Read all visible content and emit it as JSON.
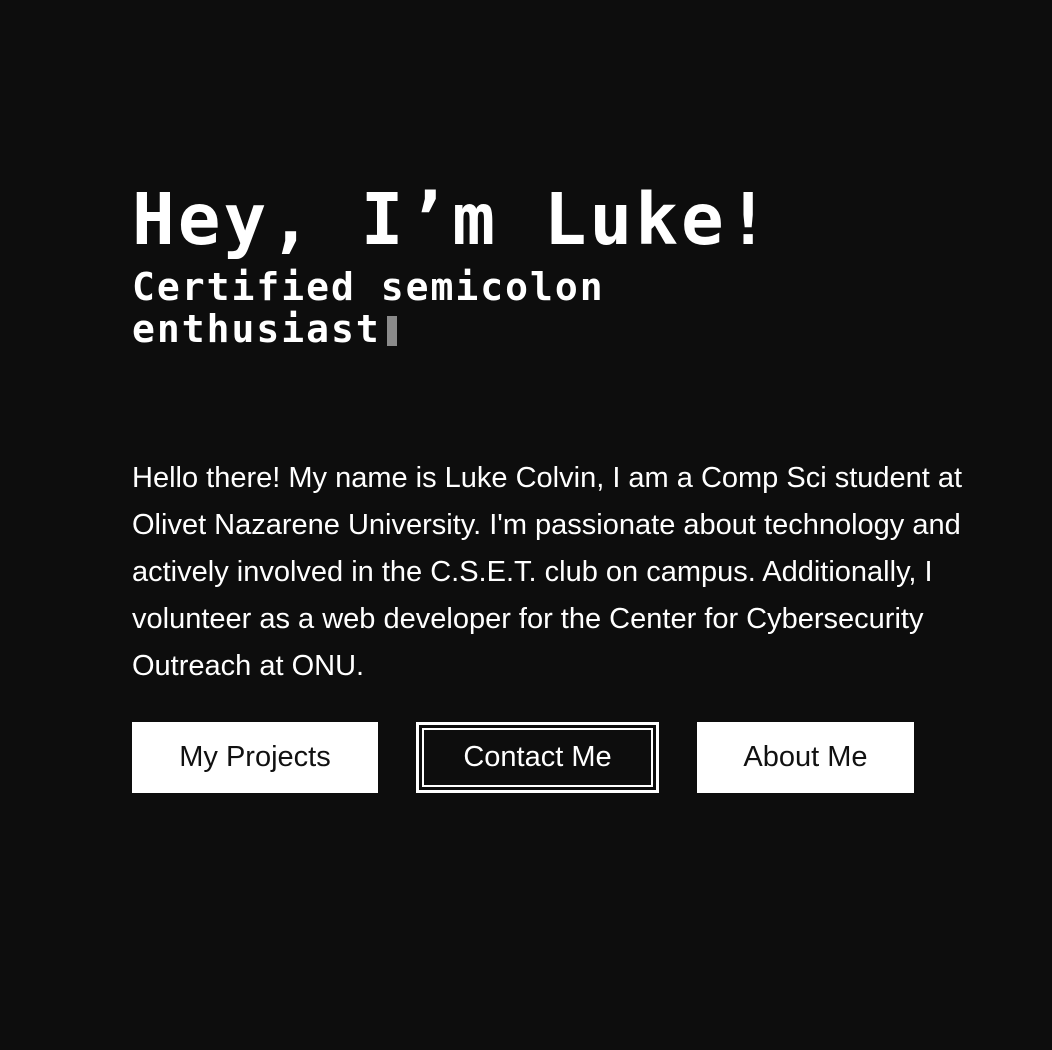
{
  "hero": {
    "headline": "Hey, I’m Luke!",
    "tagline": "Certified semicolon enthusiast"
  },
  "bio": {
    "text": "Hello there! My name is Luke Colvin, I am a Comp Sci student at Olivet Nazarene University. I'm passionate about technology and actively involved in the C.S.E.T. club on campus. Additionally, I volunteer as a web developer for the Center for Cybersecurity Outreach at ONU."
  },
  "actions": {
    "projects_label": "My Projects",
    "contact_label": "Contact Me",
    "about_label": "About Me"
  },
  "colors": {
    "background": "#0d0d0d",
    "text": "#ffffff",
    "cursor": "#8a8a8a"
  }
}
